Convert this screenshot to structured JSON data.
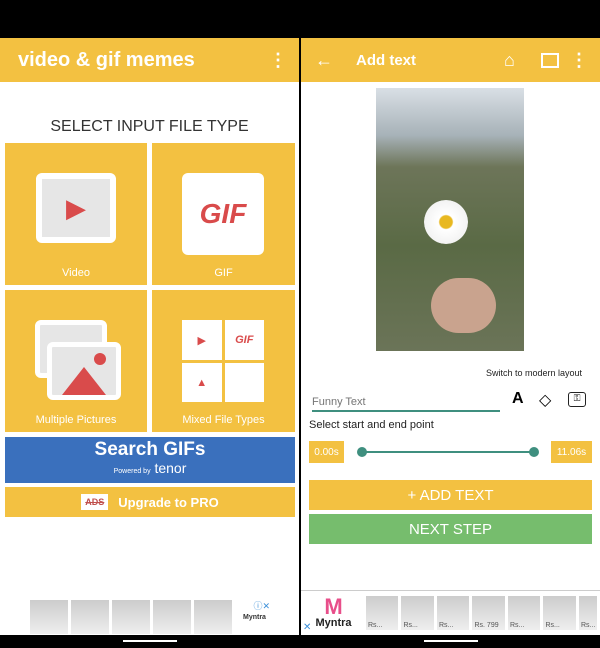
{
  "left": {
    "app_title": "video & gif memes",
    "heading": "SELECT INPUT FILE TYPE",
    "tiles": [
      {
        "label": "Video",
        "icon": "video-film-icon"
      },
      {
        "label": "GIF",
        "icon_text": "GIF"
      },
      {
        "label": "Multiple Pictures",
        "icon": "pictures-icon"
      },
      {
        "label": "Mixed File Types",
        "icon_text": "GIF"
      }
    ],
    "search_gifs": "Search GIFs",
    "powered_by": "Powered by",
    "tenor": "tenor",
    "ads_badge": "ADS",
    "upgrade": "Upgrade to PRO",
    "ad_brand": "Myntra"
  },
  "right": {
    "title": "Add text",
    "switch_layout": "Switch to modern layout",
    "text_placeholder": "Funny Text",
    "select_label": "Select start and end point",
    "start_time": "0.00s",
    "end_time": "11.06s",
    "add_text": "+ ADD TEXT",
    "next_step": "NEXT STEP",
    "ad_brand": "Myntra",
    "ad_prices": [
      "Rs...",
      "Rs...",
      "Rs...",
      "Rs. 799",
      "Rs...",
      "Rs...",
      "Rs..."
    ]
  },
  "colors": {
    "yellow": "#f3c141",
    "blue": "#3a70bd",
    "green": "#76bd6d",
    "teal": "#3f8f7f"
  }
}
